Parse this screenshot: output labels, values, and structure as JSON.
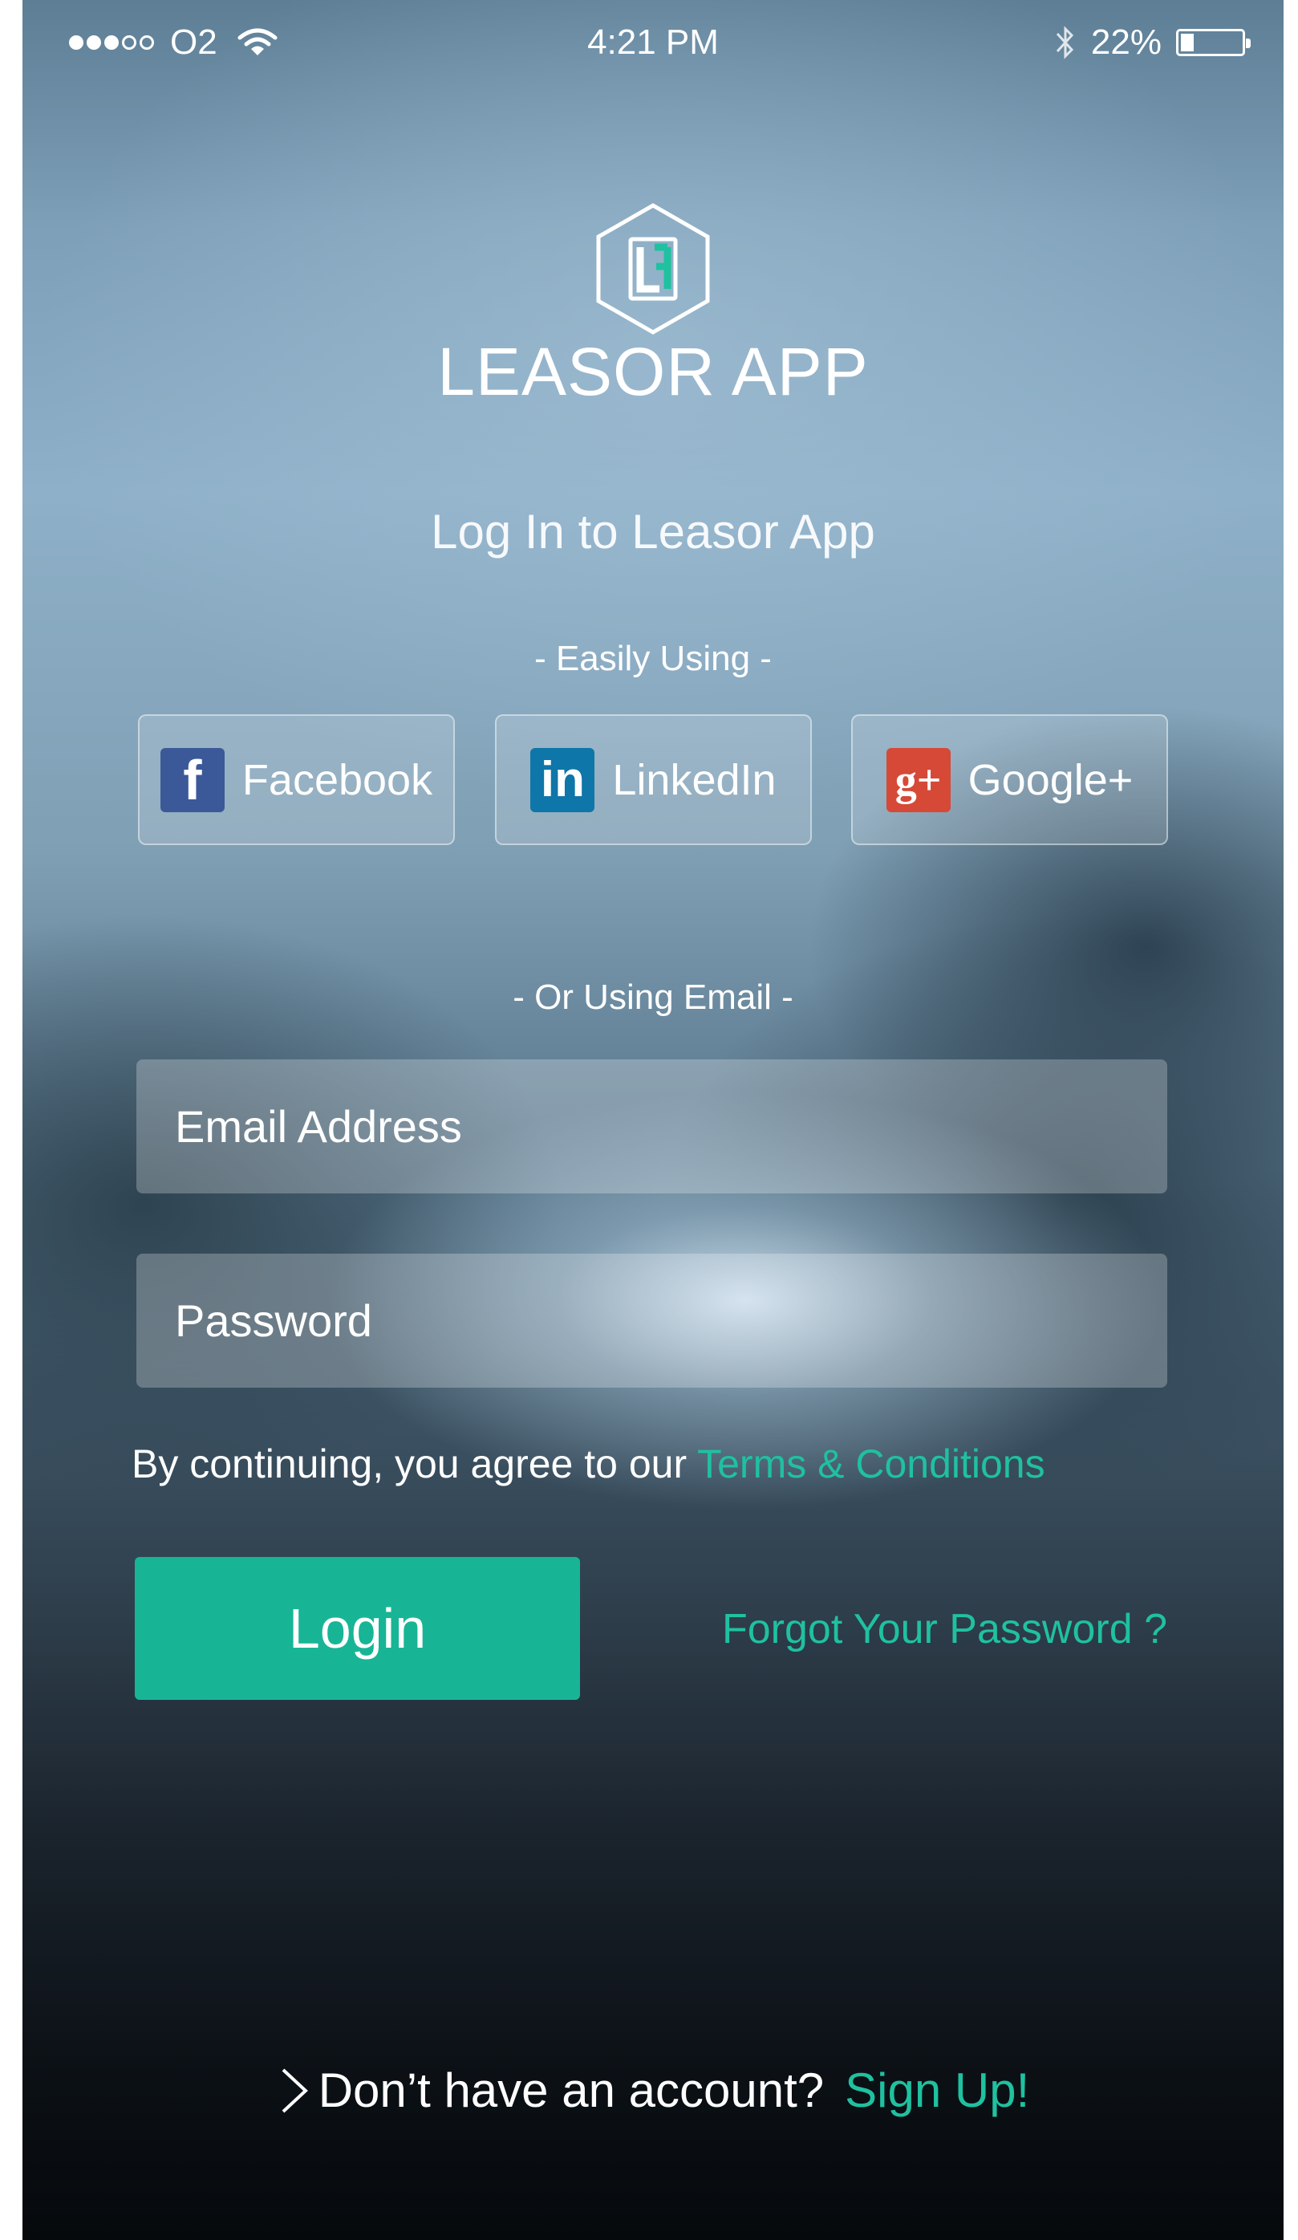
{
  "status_bar": {
    "carrier": "O2",
    "signal_bars_filled": 3,
    "signal_bars_total": 5,
    "time": "4:21 PM",
    "battery_percent_label": "22%",
    "battery_level": 0.22,
    "icons": [
      "wifi-icon",
      "bluetooth-icon",
      "battery-icon"
    ]
  },
  "branding": {
    "logo_icon": "hexagon-logo-icon",
    "app_name": "LEASOR APP"
  },
  "login": {
    "title": "Log In to Leasor App",
    "social_label": "- Easily Using -",
    "social_buttons": [
      {
        "label": "Facebook",
        "icon": "facebook-icon",
        "glyph": "f",
        "color": "#3b5998"
      },
      {
        "label": "LinkedIn",
        "icon": "linkedin-icon",
        "glyph": "in",
        "color": "#0e76a8"
      },
      {
        "label": "Google+",
        "icon": "google-plus-icon",
        "glyph": "g+",
        "color": "#d64937"
      }
    ],
    "email_label": "- Or Using Email -",
    "email_placeholder": "Email Address",
    "password_placeholder": "Password",
    "terms_prefix": "By continuing, you agree to our ",
    "terms_link": "Terms & Conditions",
    "login_button": "Login",
    "forgot_link": "Forgot Your Password ?",
    "signup_prefix": "Don’t have an account?",
    "signup_link": "Sign Up!"
  },
  "colors": {
    "accent": "#17b596",
    "link": "#1fc1a0"
  }
}
